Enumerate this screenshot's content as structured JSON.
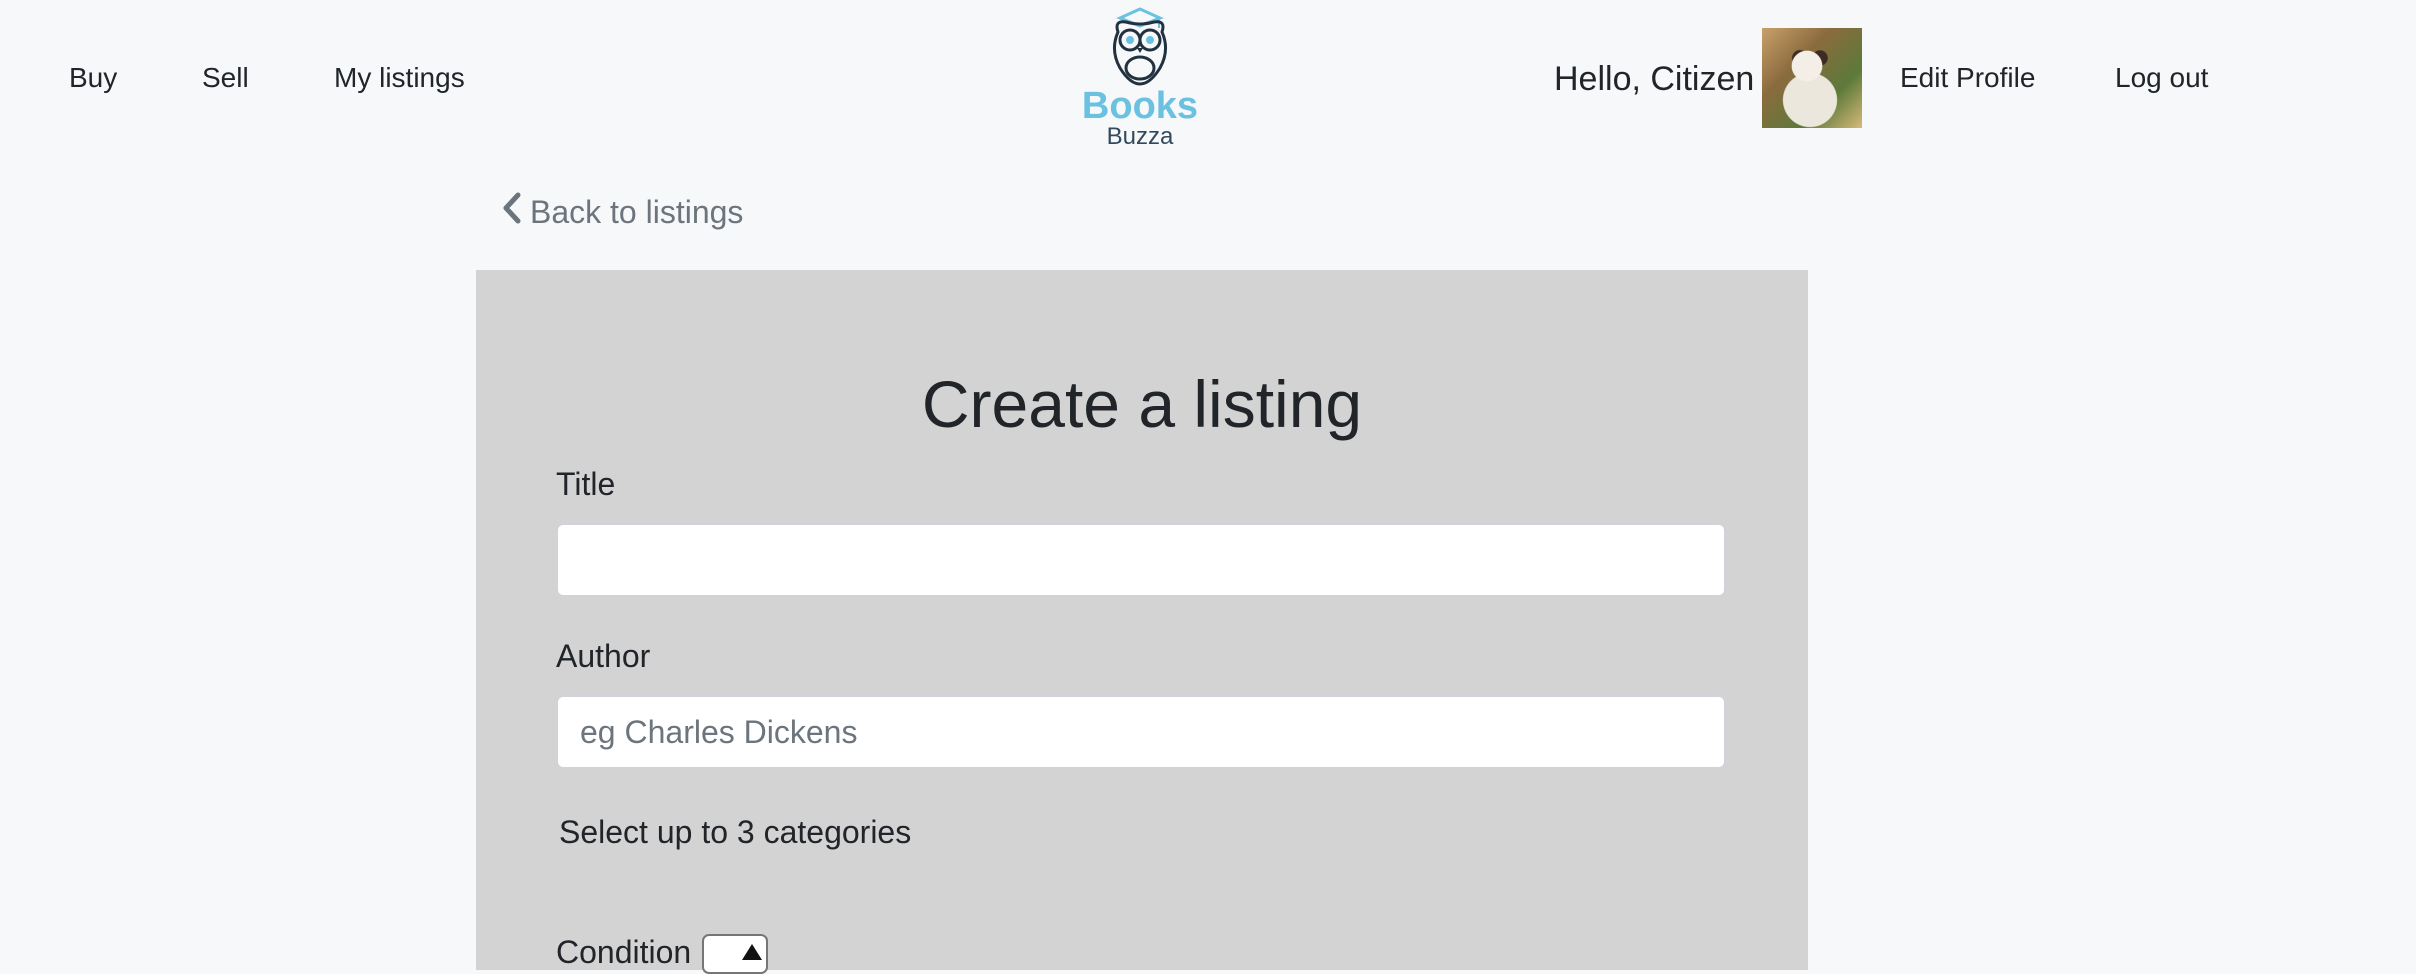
{
  "nav": {
    "buy": "Buy",
    "sell": "Sell",
    "my_listings": "My listings"
  },
  "logo": {
    "line1": "Books",
    "line2": "Buzza",
    "icon": "owl-icon",
    "colors": {
      "accent": "#6bc1e0",
      "secondary": "#34495e"
    }
  },
  "user": {
    "greeting": "Hello, Citizen",
    "edit_profile": "Edit Profile",
    "logout": "Log out"
  },
  "back": {
    "icon": "chevron-left-icon",
    "label": "Back to listings"
  },
  "form": {
    "title": "Create a listing",
    "title_label": "Title",
    "title_value": "",
    "title_placeholder": "",
    "author_label": "Author",
    "author_value": "",
    "author_placeholder": "eg Charles Dickens",
    "categories_label": "Select up to 3 categories",
    "condition_label": "Condition"
  },
  "colors": {
    "page_bg": "#f7f8fa",
    "card_bg": "#d3d3d3",
    "muted_text": "#6c757d"
  }
}
